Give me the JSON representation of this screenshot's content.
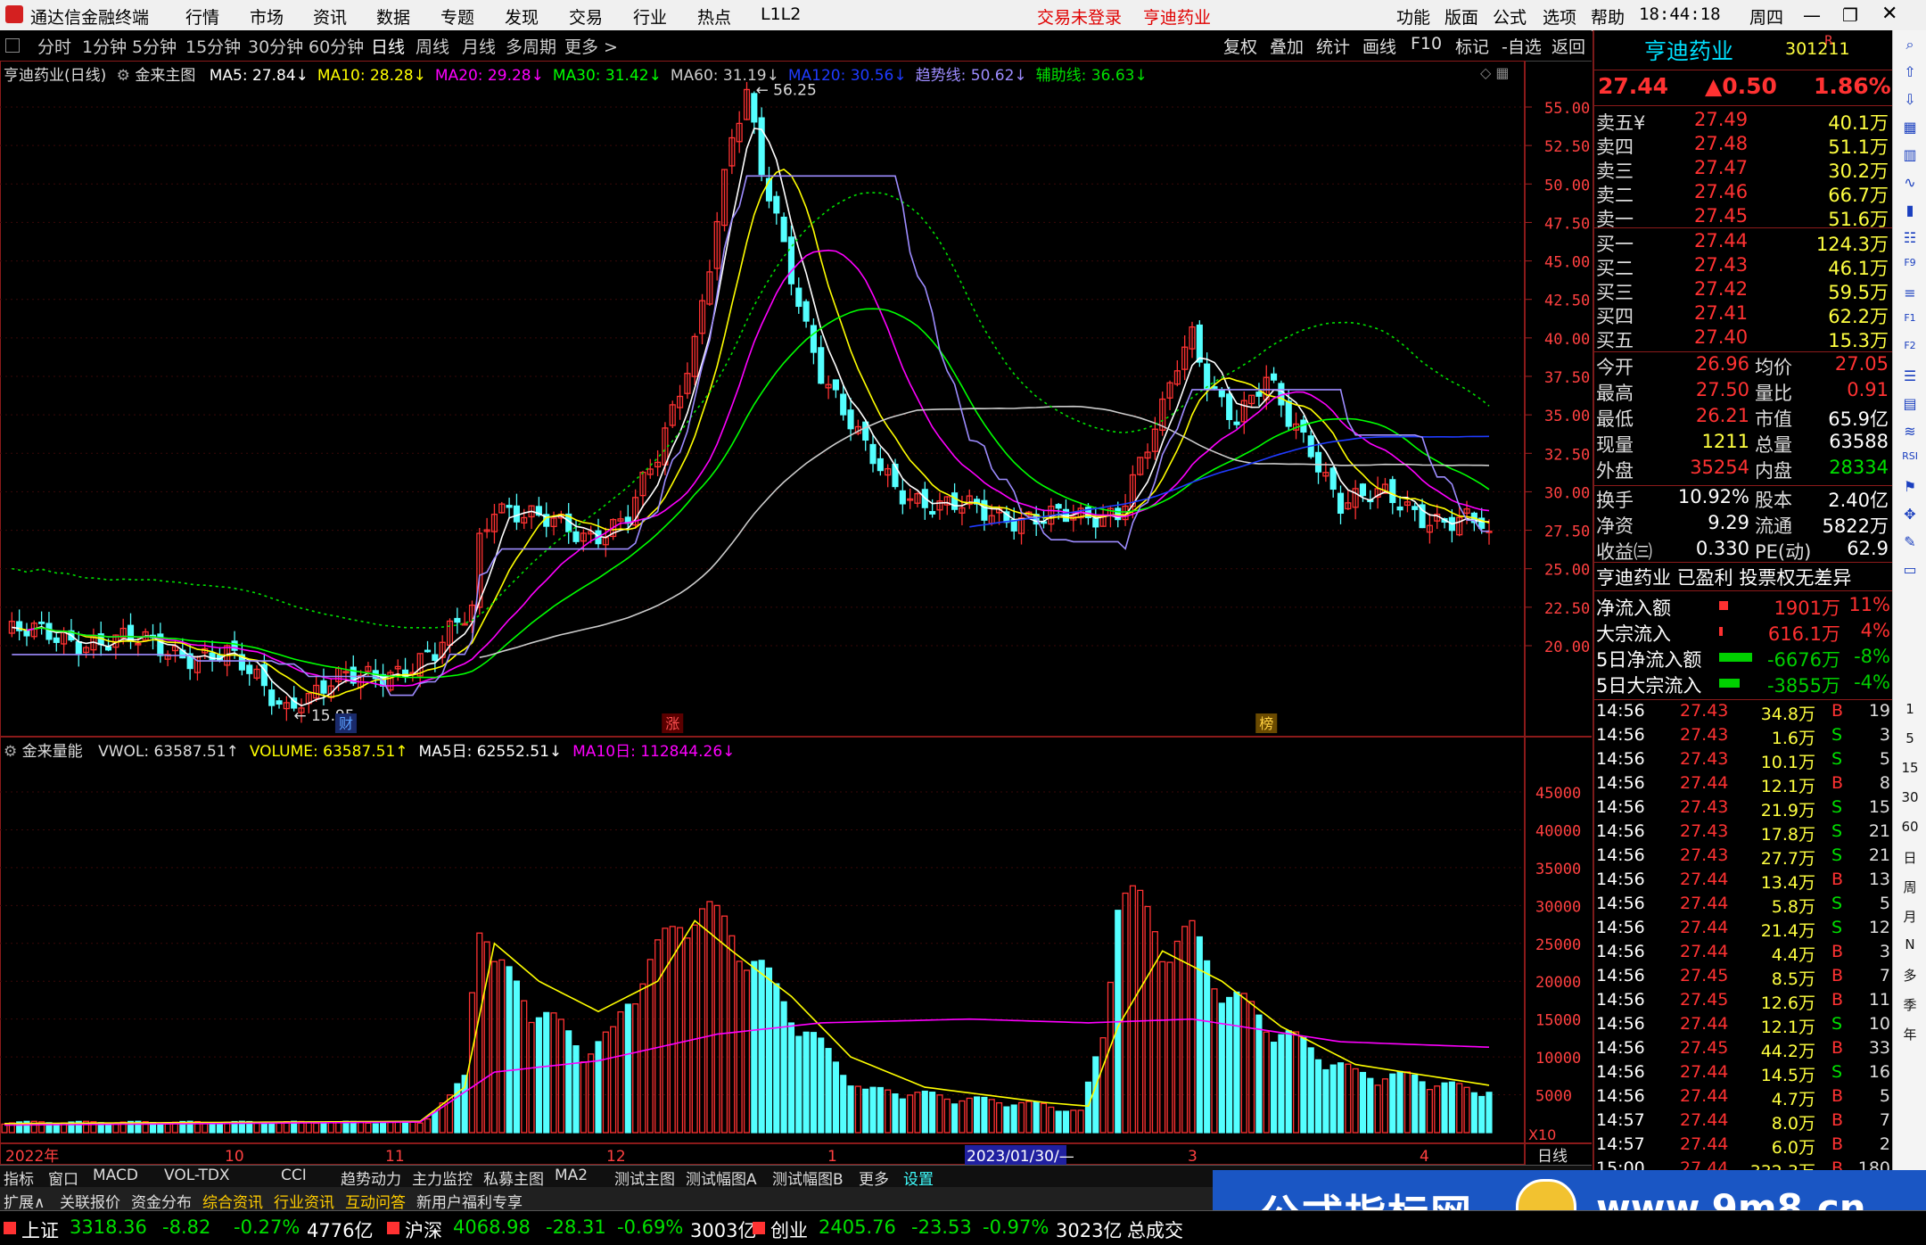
{
  "menubar": {
    "app_title": "通达信金融终端",
    "menus": [
      "行情",
      "市场",
      "资讯",
      "数据",
      "专题",
      "发现",
      "交易",
      "行业",
      "热点",
      "L1L2"
    ],
    "status_text": "交易未登录",
    "stock_name": "亨迪药业",
    "right_menus": [
      "功能",
      "版面",
      "公式",
      "选项",
      "帮助"
    ],
    "clock": "18:44:18",
    "weekday": "周四"
  },
  "periods": [
    "分时",
    "1分钟",
    "5分钟",
    "15分钟",
    "30分钟",
    "60分钟",
    "日线",
    "周线",
    "月线",
    "多周期",
    "更多 >"
  ],
  "active_period": "日线",
  "toolbar_right": [
    "复权",
    "叠加",
    "统计",
    "画线",
    "F10",
    "标记",
    "-自选",
    "返回"
  ],
  "main_legend": {
    "title": "亨迪药业(日线)",
    "indicator": "金来主图",
    "items": [
      {
        "text": "MA5: 27.84↓",
        "color": "#ffffff"
      },
      {
        "text": "MA10: 28.28↓",
        "color": "#ffff00"
      },
      {
        "text": "MA20: 29.28↓",
        "color": "#ff00ff"
      },
      {
        "text": "MA30: 31.42↓",
        "color": "#00ff00"
      },
      {
        "text": "MA60: 31.19↓",
        "color": "#cccccc"
      },
      {
        "text": "MA120: 30.56↓",
        "color": "#1f3bff"
      },
      {
        "text": "趋势线: 50.62↓",
        "color": "#9d8cff"
      },
      {
        "text": "辅助线: 36.63↓",
        "color": "#00e000"
      }
    ]
  },
  "vol_legend": {
    "indicator": "金来量能",
    "items": [
      {
        "text": "VWOL: 63587.51↑",
        "color": "#dddddd"
      },
      {
        "text": "VOLUME: 63587.51↑",
        "color": "#ffff00"
      },
      {
        "text": "MA5日: 62552.51↓",
        "color": "#ffffff"
      },
      {
        "text": "MA10日: 112844.26↓",
        "color": "#ff00ff"
      }
    ]
  },
  "price_axis": [
    "55.00",
    "52.50",
    "50.00",
    "47.50",
    "45.00",
    "42.50",
    "40.00",
    "37.50",
    "35.00",
    "32.50",
    "30.00",
    "27.50",
    "25.00",
    "22.50",
    "20.00"
  ],
  "vol_axis": [
    "45000",
    "40000",
    "35000",
    "30000",
    "25000",
    "20000",
    "15000",
    "10000",
    "5000"
  ],
  "vol_axis_unit": "X10",
  "date_axis": {
    "labels": [
      "2022年",
      "10",
      "11",
      "12",
      "1",
      "2023/01/30/—",
      "3",
      "4"
    ],
    "right": "日线"
  },
  "annotations": {
    "high": "56.25",
    "low": "15.95",
    "marks": [
      "财",
      "涨",
      "榜"
    ]
  },
  "quote": {
    "name": "亨迪药业",
    "code": "301211",
    "flag": "R",
    "price": "27.44",
    "change": "▲0.50",
    "pct": "1.86%",
    "asks": [
      {
        "label": "卖五",
        "p": "27.49",
        "v": "40.1万",
        "mark": "¥"
      },
      {
        "label": "卖四",
        "p": "27.48",
        "v": "51.1万",
        "mark": ""
      },
      {
        "label": "卖三",
        "p": "27.47",
        "v": "30.2万",
        "mark": ""
      },
      {
        "label": "卖二",
        "p": "27.46",
        "v": "66.7万",
        "mark": ""
      },
      {
        "label": "卖一",
        "p": "27.45",
        "v": "51.6万",
        "mark": ""
      }
    ],
    "bids": [
      {
        "label": "买一",
        "p": "27.44",
        "v": "124.3万"
      },
      {
        "label": "买二",
        "p": "27.43",
        "v": "46.1万"
      },
      {
        "label": "买三",
        "p": "27.42",
        "v": "59.5万"
      },
      {
        "label": "买四",
        "p": "27.41",
        "v": "62.2万"
      },
      {
        "label": "买五",
        "p": "27.40",
        "v": "15.3万"
      }
    ],
    "stats": [
      [
        "今开",
        "26.96",
        "均价",
        "27.05"
      ],
      [
        "最高",
        "27.50",
        "量比",
        "0.91"
      ],
      [
        "最低",
        "26.21",
        "市值",
        "65.9亿"
      ],
      [
        "现量",
        "1211",
        "总量",
        "63588"
      ],
      [
        "外盘",
        "35254",
        "内盘",
        "28334"
      ],
      [
        "换手",
        "10.92%",
        "股本",
        "2.40亿"
      ],
      [
        "净资",
        "9.29",
        "流通",
        "5822万"
      ],
      [
        "收益㈢",
        "0.330",
        "PE(动)",
        "62.9"
      ]
    ],
    "info_line": "亨迪药业 已盈利 投票权无差异",
    "flows": [
      {
        "label": "净流入额",
        "v": "1901万",
        "pct": "11%",
        "bar": 0.12,
        "color": "#ff3030"
      },
      {
        "label": "大宗流入",
        "v": "616.1万",
        "pct": "4%",
        "bar": 0.03,
        "color": "#ff3030"
      },
      {
        "label": "5日净流入额",
        "v": "-6676万",
        "pct": "-8%",
        "bar": 0.5,
        "color": "#00d000"
      },
      {
        "label": "5日大宗流入",
        "v": "-3855万",
        "pct": "-4%",
        "bar": 0.3,
        "color": "#00d000"
      }
    ],
    "ticks": [
      [
        "14:56",
        "27.43",
        "34.8万",
        "B",
        "19"
      ],
      [
        "14:56",
        "27.43",
        "1.6万",
        "S",
        "3"
      ],
      [
        "14:56",
        "27.43",
        "10.1万",
        "S",
        "5"
      ],
      [
        "14:56",
        "27.44",
        "12.1万",
        "B",
        "8"
      ],
      [
        "14:56",
        "27.43",
        "21.9万",
        "S",
        "15"
      ],
      [
        "14:56",
        "27.43",
        "17.8万",
        "S",
        "21"
      ],
      [
        "14:56",
        "27.43",
        "27.7万",
        "S",
        "21"
      ],
      [
        "14:56",
        "27.44",
        "13.4万",
        "B",
        "13"
      ],
      [
        "14:56",
        "27.44",
        "5.8万",
        "S",
        "5"
      ],
      [
        "14:56",
        "27.44",
        "21.4万",
        "S",
        "12"
      ],
      [
        "14:56",
        "27.44",
        "4.4万",
        "B",
        "3"
      ],
      [
        "14:56",
        "27.45",
        "8.5万",
        "B",
        "7"
      ],
      [
        "14:56",
        "27.45",
        "12.6万",
        "B",
        "11"
      ],
      [
        "14:56",
        "27.44",
        "12.1万",
        "S",
        "10"
      ],
      [
        "14:56",
        "27.45",
        "44.2万",
        "B",
        "33"
      ],
      [
        "14:56",
        "27.44",
        "14.5万",
        "S",
        "16"
      ],
      [
        "14:56",
        "27.44",
        "4.7万",
        "B",
        "5"
      ],
      [
        "14:57",
        "27.44",
        "8.0万",
        "B",
        "7"
      ],
      [
        "14:57",
        "27.44",
        "6.0万",
        "B",
        "2"
      ],
      [
        "15:00",
        "27.44",
        "332.3万",
        "B",
        "180"
      ]
    ]
  },
  "iconstrip": [
    "1",
    "5",
    "15",
    "30",
    "60",
    "日",
    "周",
    "月",
    "N",
    "多",
    "季",
    "年"
  ],
  "bottom_tabs": [
    "指标",
    "窗口",
    "MACD",
    "VOL-TDX",
    "CCI",
    "趋势动力",
    "主力监控",
    "私募主图",
    "MA2",
    "测试主图",
    "测试幅图A",
    "测试幅图B",
    "更多",
    "设置"
  ],
  "bottom_tabs2": [
    "扩展∧",
    "关联报价",
    "资金分布",
    "综合资讯",
    "行业资讯",
    "互动问答",
    "新用户福利专享"
  ],
  "status": [
    {
      "name": "上证",
      "v": "3318.36",
      "c": "-8.82",
      "p": "-0.27%",
      "a": "4776亿"
    },
    {
      "name": "沪深",
      "v": "4068.98",
      "c": "-28.31",
      "p": "-0.69%",
      "a": "3003亿"
    },
    {
      "name": "创业",
      "v": "2405.76",
      "c": "-23.53",
      "p": "-0.97%",
      "a": "3023亿"
    }
  ],
  "status_tail": "总成交",
  "logo": {
    "text": "公式指标网",
    "url": "www.9m8.cn"
  },
  "colors": {
    "up": "#ff3232",
    "down": "#54ffff",
    "ma5": "#ffffff",
    "ma10": "#ffff00",
    "ma20": "#ff00ff",
    "ma30": "#00ff00",
    "ma60": "#cccccc",
    "ma120": "#1f3bff",
    "trend": "#9d8cff",
    "aux": "#00e000"
  },
  "chart_data": {
    "type": "candlestick",
    "ylim": [
      15.95,
      56.25
    ],
    "price_path": [
      [
        0,
        20.8
      ],
      [
        10,
        20.5
      ],
      [
        20,
        20.0
      ],
      [
        30,
        19.2
      ],
      [
        38,
        16.2
      ],
      [
        45,
        17.5
      ],
      [
        52,
        18.5
      ],
      [
        58,
        19.2
      ],
      [
        63,
        22.5
      ],
      [
        64,
        27.0
      ],
      [
        66,
        29.5
      ],
      [
        72,
        28.0
      ],
      [
        78,
        27.2
      ],
      [
        82,
        28.0
      ],
      [
        84,
        28.5
      ],
      [
        88,
        32.0
      ],
      [
        90,
        35.0
      ],
      [
        93,
        40.0
      ],
      [
        96,
        48.0
      ],
      [
        98,
        53.0
      ],
      [
        100,
        55.5
      ],
      [
        102,
        50.5
      ],
      [
        105,
        46.0
      ],
      [
        108,
        41.0
      ],
      [
        110,
        38.0
      ],
      [
        113,
        35.0
      ],
      [
        116,
        32.5
      ],
      [
        120,
        30.5
      ],
      [
        126,
        29.0
      ],
      [
        132,
        28.6
      ],
      [
        138,
        28.5
      ],
      [
        145,
        28.0
      ],
      [
        150,
        29.0
      ],
      [
        153,
        32.0
      ],
      [
        156,
        35.0
      ],
      [
        158,
        38.0
      ],
      [
        160,
        40.0
      ],
      [
        162,
        37.5
      ],
      [
        166,
        35.0
      ],
      [
        170,
        37.0
      ],
      [
        173,
        34.5
      ],
      [
        176,
        33.0
      ],
      [
        180,
        29.5
      ],
      [
        186,
        29.5
      ],
      [
        192,
        28.5
      ],
      [
        197,
        28.0
      ],
      [
        200,
        27.44
      ]
    ],
    "volume_path": [
      [
        0,
        1500
      ],
      [
        30,
        1500
      ],
      [
        56,
        1500
      ],
      [
        60,
        5000
      ],
      [
        62,
        8000
      ],
      [
        64,
        35000
      ],
      [
        66,
        24000
      ],
      [
        72,
        18000
      ],
      [
        78,
        12000
      ],
      [
        82,
        14000
      ],
      [
        86,
        24000
      ],
      [
        90,
        28000
      ],
      [
        93,
        34000
      ],
      [
        96,
        30000
      ],
      [
        100,
        27000
      ],
      [
        104,
        20000
      ],
      [
        108,
        15000
      ],
      [
        112,
        10000
      ],
      [
        116,
        6000
      ],
      [
        120,
        6000
      ],
      [
        128,
        5000
      ],
      [
        140,
        4000
      ],
      [
        145,
        3000
      ],
      [
        148,
        14000
      ],
      [
        150,
        36000
      ],
      [
        156,
        28000
      ],
      [
        160,
        28000
      ],
      [
        165,
        20000
      ],
      [
        170,
        16000
      ],
      [
        176,
        12000
      ],
      [
        182,
        8500
      ],
      [
        190,
        8000
      ],
      [
        198,
        6000
      ],
      [
        200,
        6358
      ]
    ],
    "ma5_vol_path": [
      [
        0,
        1200
      ],
      [
        56,
        1500
      ],
      [
        62,
        6000
      ],
      [
        66,
        25000
      ],
      [
        72,
        20000
      ],
      [
        80,
        16000
      ],
      [
        88,
        20000
      ],
      [
        93,
        28000
      ],
      [
        98,
        24000
      ],
      [
        106,
        18000
      ],
      [
        114,
        10000
      ],
      [
        124,
        6000
      ],
      [
        140,
        4000
      ],
      [
        146,
        3500
      ],
      [
        150,
        14000
      ],
      [
        156,
        24000
      ],
      [
        164,
        20000
      ],
      [
        172,
        14000
      ],
      [
        182,
        9000
      ],
      [
        200,
        6255
      ]
    ],
    "ma10_vol_path": [
      [
        0,
        1000
      ],
      [
        56,
        1400
      ],
      [
        66,
        8000
      ],
      [
        80,
        9500
      ],
      [
        96,
        13000
      ],
      [
        110,
        14500
      ],
      [
        130,
        15000
      ],
      [
        146,
        14500
      ],
      [
        160,
        15000
      ],
      [
        180,
        12000
      ],
      [
        200,
        11284
      ]
    ]
  }
}
